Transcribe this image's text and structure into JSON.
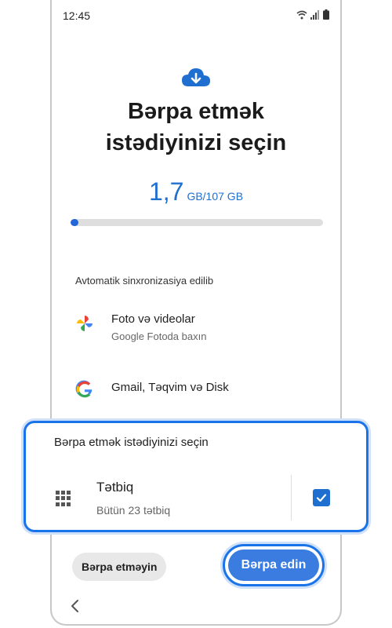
{
  "status": {
    "time": "12:45",
    "icons": [
      "wifi-icon",
      "signal-icon",
      "battery-icon"
    ]
  },
  "header": {
    "icon": "cloud-download-icon",
    "title_line1": "Bərpa etmək",
    "title_line2": "istədiyinizi seçin"
  },
  "storage": {
    "used": "1,7",
    "unit_total": "GB/107 GB",
    "progress_fraction": 0.016
  },
  "sync_section": {
    "label": "Avtomatik sinxronizasiya edilib",
    "items": [
      {
        "icon": "google-photos-icon",
        "title": "Foto və videolar",
        "subtitle": "Google Fotoda baxın"
      },
      {
        "icon": "google-icon",
        "title": "Gmail, Təqvim və Disk"
      }
    ]
  },
  "restore_panel": {
    "title": "Bərpa etmək istədiyinizi seçin",
    "app_item": {
      "icon": "apps-grid-icon",
      "name": "Tətbiq",
      "count": "Bütün 23 tətbiq",
      "checked": true
    }
  },
  "actions": {
    "skip_label": "Bərpa etməyin",
    "restore_label": "Bərpa edin"
  },
  "nav": {
    "back_icon": "back-icon"
  },
  "colors": {
    "accent": "#1a73e8",
    "button_primary": "#3a7ce0",
    "progress": "#2266d9"
  }
}
